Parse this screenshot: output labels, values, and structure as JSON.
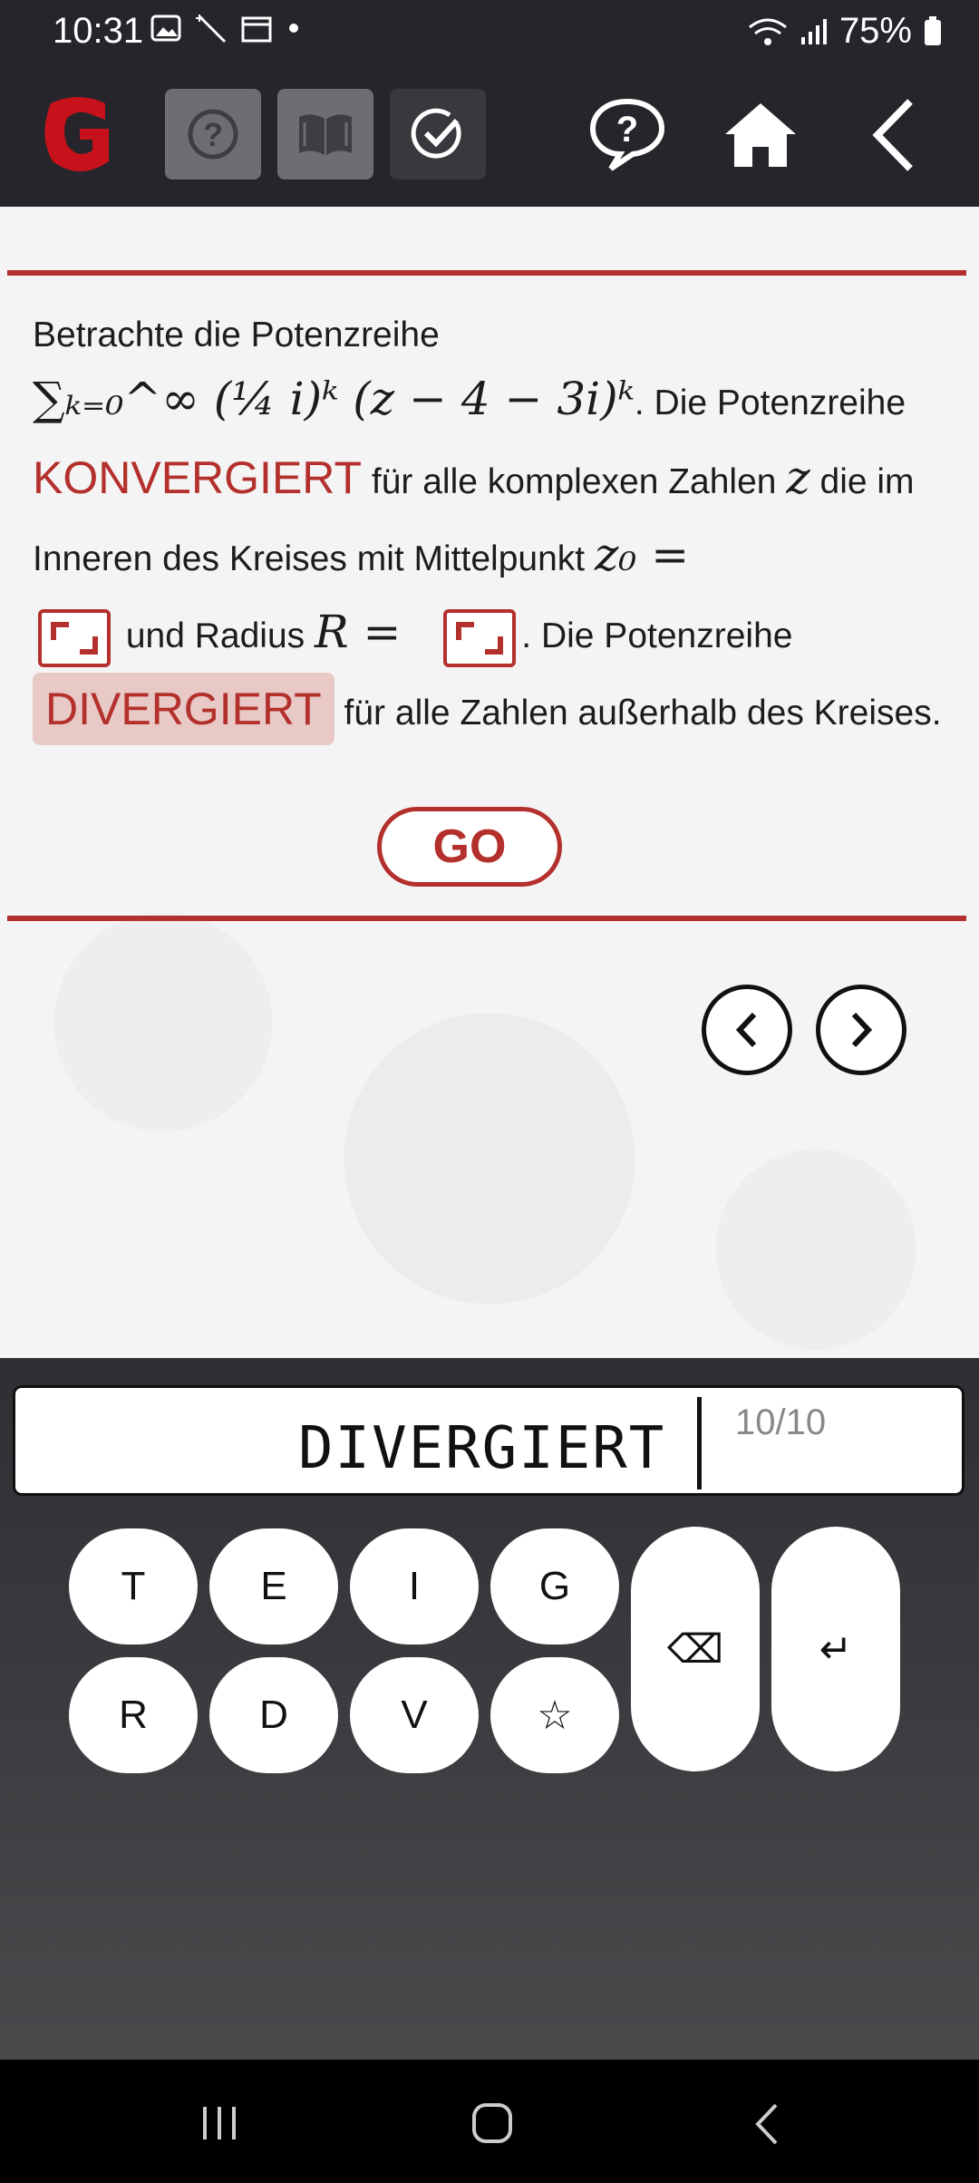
{
  "status_bar": {
    "time": "10:31",
    "battery": "75%"
  },
  "task": {
    "line1": "Betrachte die Potenzreihe",
    "series_formula": "∑ₖ₌₀^∞ (¼ i)ᵏ (z − 4 − 3i)ᵏ",
    "after_formula": ". Die Potenzreihe",
    "keyword_1": "KONVERGIERT",
    "text_1": "für alle komplexen Zahlen",
    "var_z": "z",
    "text_2": "die im Inneren des Kreises mit Mittelpunkt",
    "var_z0": "z₀ =",
    "text_3": "und Radius",
    "var_R": "R =",
    "text_4": ". Die Potenzreihe",
    "keyword_2": "DIVERGIERT",
    "text_5": "für alle Zahlen außerhalb des Kreises."
  },
  "go_button": "GO",
  "input": {
    "value": "DIVERGIERT",
    "counter": "10/10"
  },
  "keyboard": {
    "row1": [
      "T",
      "E",
      "I",
      "G"
    ],
    "row2": [
      "R",
      "D",
      "V",
      "☆"
    ],
    "backspace": "⌫",
    "enter": "↵"
  },
  "colors": {
    "accent": "#b3302c",
    "bar": "#25252b"
  }
}
